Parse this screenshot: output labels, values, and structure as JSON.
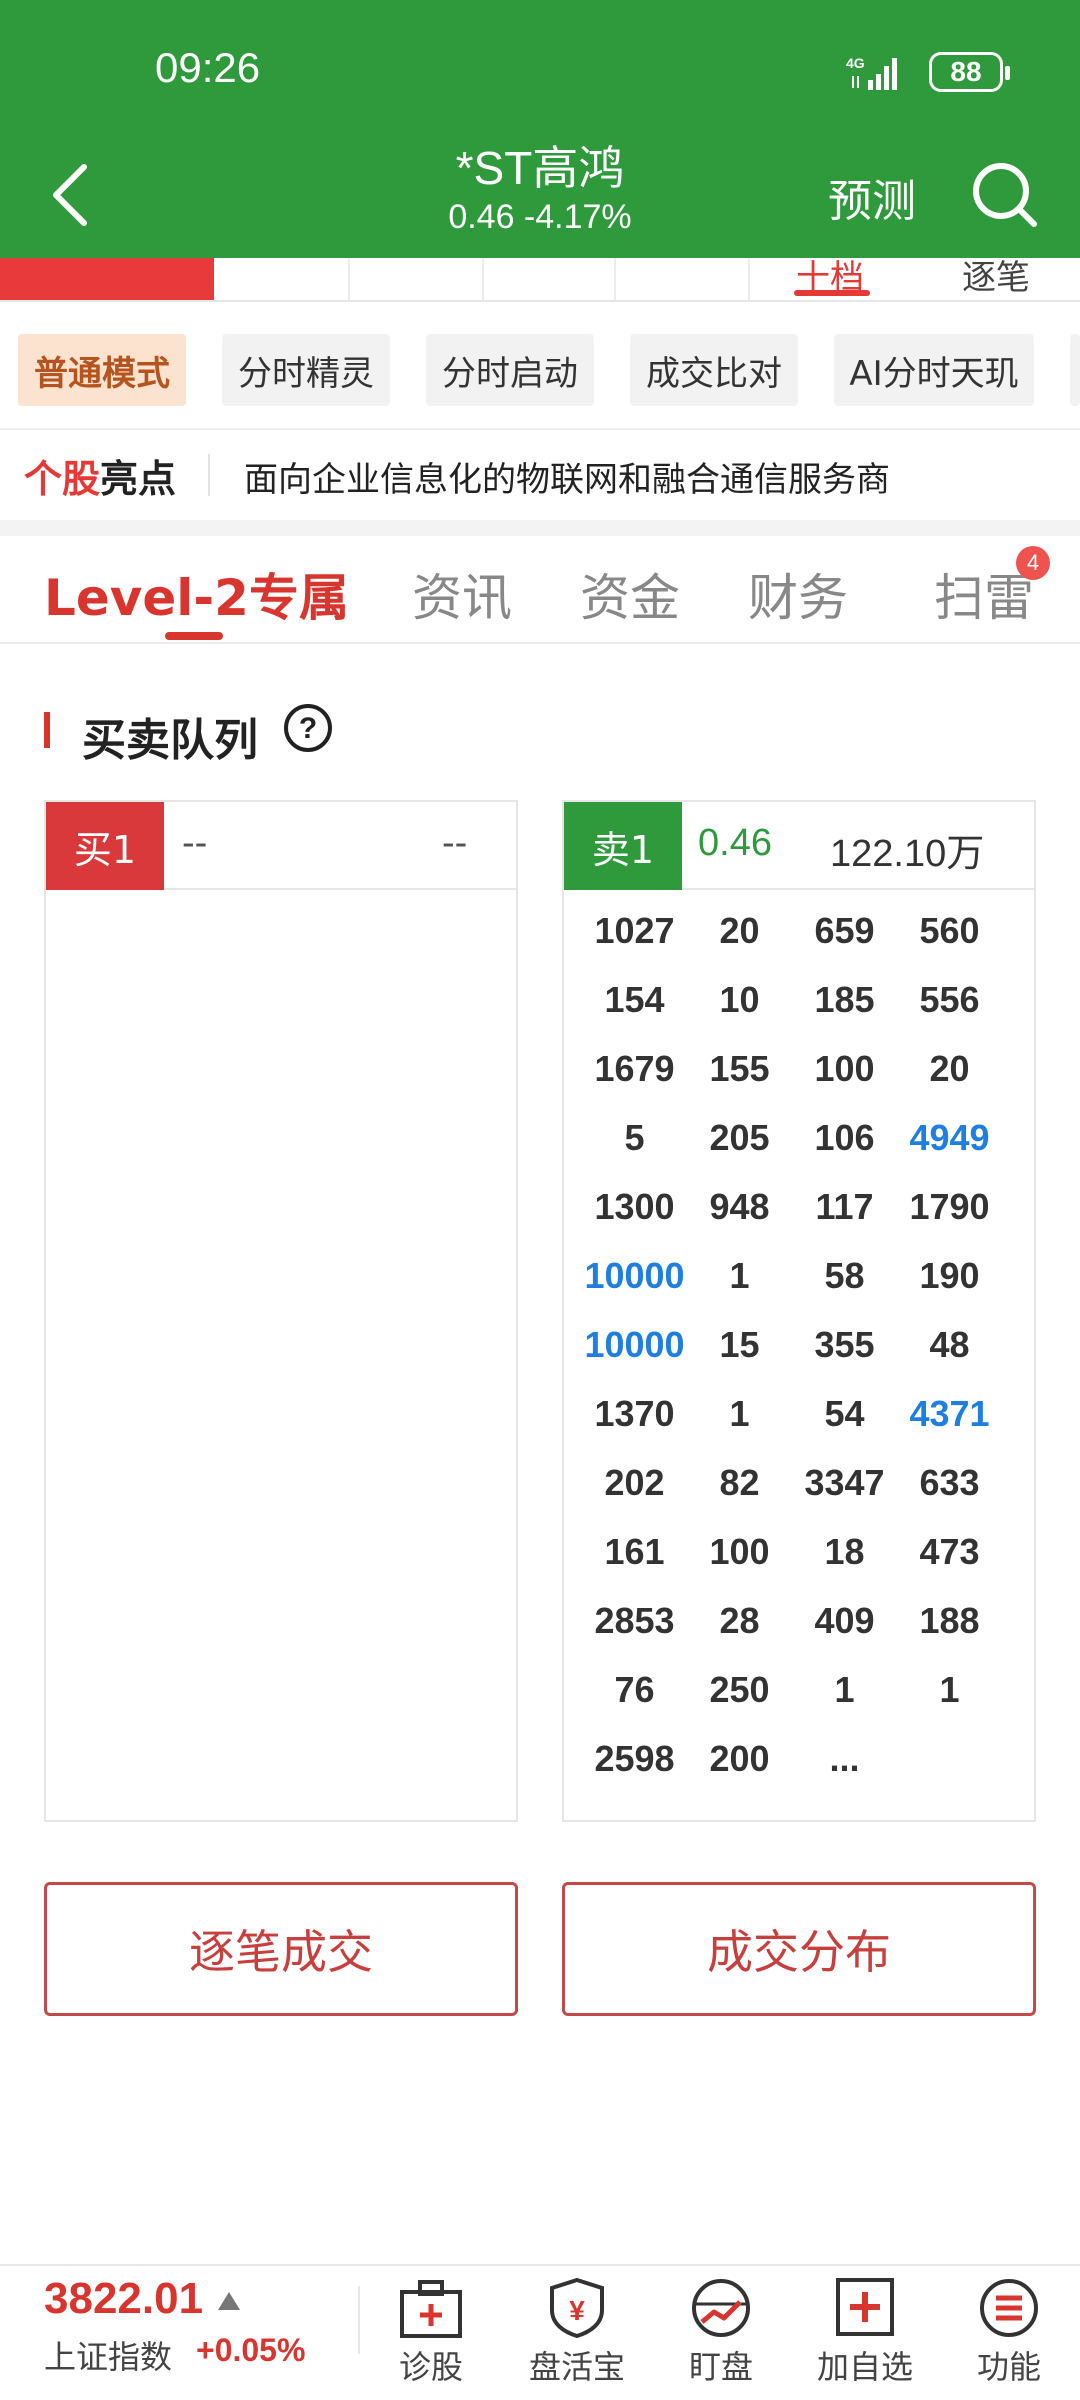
{
  "status_bar": {
    "time": "09:26",
    "network": "4G",
    "battery": "88"
  },
  "header": {
    "title": "*ST高鸿",
    "price_line": "0.46  -4.17%",
    "predict_label": "预测"
  },
  "strip": {
    "tab_1": "十档",
    "tab_2": "逐笔"
  },
  "modes": [
    "普通模式",
    "分时精灵",
    "分时启动",
    "成交比对",
    "AI分时天玑"
  ],
  "highlight": {
    "label_red": "个股",
    "label_black": "亮点",
    "text": "面向企业信息化的物联网和融合通信服务商"
  },
  "tabs": [
    {
      "label": "Level-2专属"
    },
    {
      "label": "资讯"
    },
    {
      "label": "资金"
    },
    {
      "label": "财务"
    },
    {
      "label": "扫雷",
      "badge": "4"
    }
  ],
  "section": {
    "title": "买卖队列"
  },
  "buy_panel": {
    "tag": "买1",
    "price": "--",
    "volume": "--"
  },
  "sell_panel": {
    "tag": "卖1",
    "price": "0.46",
    "volume": "122.10万",
    "rows": [
      [
        "1027",
        "20",
        "659",
        "560"
      ],
      [
        "154",
        "10",
        "185",
        "556"
      ],
      [
        "1679",
        "155",
        "100",
        "20"
      ],
      [
        "5",
        "205",
        "106",
        "4949"
      ],
      [
        "1300",
        "948",
        "117",
        "1790"
      ],
      [
        "10000",
        "1",
        "58",
        "190"
      ],
      [
        "10000",
        "15",
        "355",
        "48"
      ],
      [
        "1370",
        "1",
        "54",
        "4371"
      ],
      [
        "202",
        "82",
        "3347",
        "633"
      ],
      [
        "161",
        "100",
        "18",
        "473"
      ],
      [
        "2853",
        "28",
        "409",
        "188"
      ],
      [
        "76",
        "250",
        "1",
        "1"
      ],
      [
        "2598",
        "200",
        "...",
        ""
      ]
    ],
    "highlighted": [
      "4949",
      "10000",
      "4371"
    ]
  },
  "actions": {
    "left": "逐笔成交",
    "right": "成交分布"
  },
  "bottom": {
    "index_value": "3822.01",
    "index_name": "上证指数",
    "index_change": "+0.05%",
    "nav": [
      {
        "label": "诊股",
        "icon": "kit-icon"
      },
      {
        "label": "盘活宝",
        "icon": "shield-yuan-icon"
      },
      {
        "label": "盯盘",
        "icon": "chart-circle-icon"
      },
      {
        "label": "加自选",
        "icon": "plus-box-icon"
      },
      {
        "label": "功能",
        "icon": "menu-circle-icon"
      }
    ]
  },
  "colors": {
    "header_green": "#2f9a3c",
    "accent_red": "#d9352f",
    "highlight_blue": "#1f7fe0"
  }
}
